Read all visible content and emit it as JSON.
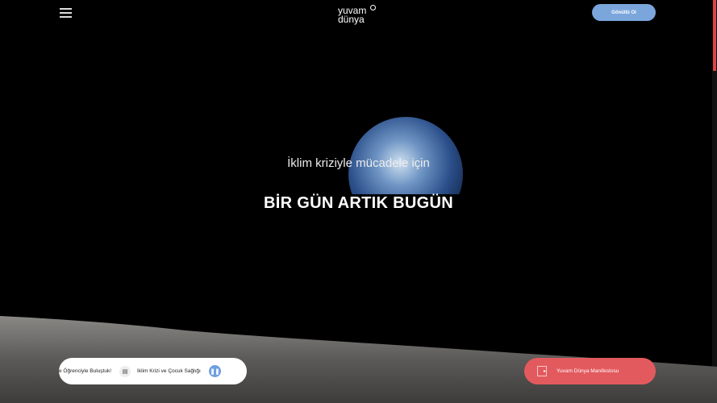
{
  "header": {
    "logo_line1": "yuvam",
    "logo_line2": "dünya",
    "volunteer_label": "Gönüllü Ol"
  },
  "hero": {
    "subtitle": "İklim kriziyle mücadele için",
    "title": "BİR GÜN ARTIK BUGÜN"
  },
  "ticker": {
    "item1": "e Öğrenciyle Buluştuk!",
    "item2": "İklim Krizi ve Çocuk Sağlığı",
    "pause_icon": "pause-icon",
    "news_icon": "newspaper-icon"
  },
  "manifesto": {
    "label": "Yuvam Dünya Manifestosu",
    "icon": "play-box-icon"
  },
  "colors": {
    "accent_blue": "#7aa6dc",
    "accent_red": "#e35a5e"
  }
}
